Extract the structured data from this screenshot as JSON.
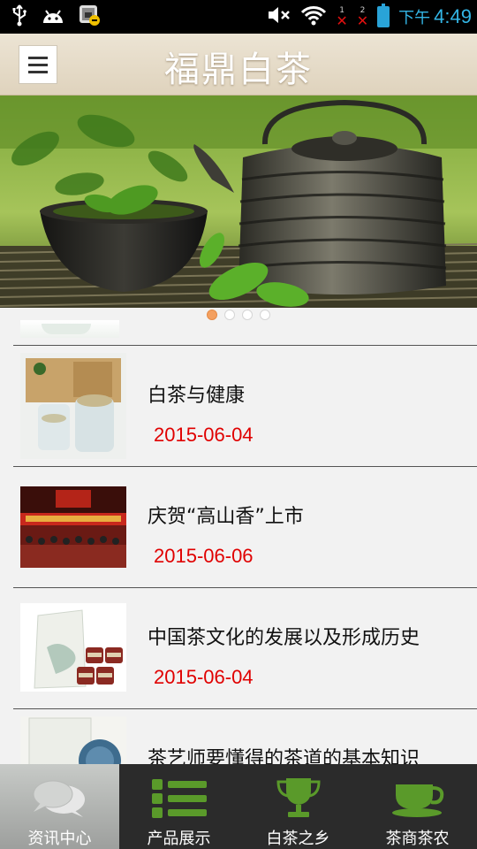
{
  "status_bar": {
    "icons": [
      "usb-icon",
      "android-icon",
      "security-shield-icon",
      "mute-icon",
      "wifi-icon",
      "sim1-no-signal-icon",
      "sim2-no-signal-icon",
      "battery-icon"
    ],
    "sim1_label": "1",
    "sim2_label": "2",
    "ampm": "下午",
    "time": "4:49"
  },
  "header": {
    "title": "福鼎白茶",
    "menu_icon": "hamburger-menu-icon"
  },
  "banner": {
    "slide_count": 4,
    "active_slide": 1
  },
  "list": {
    "items": [
      {
        "title": "白茶与健康",
        "date": "2015-06-04"
      },
      {
        "title": "庆贺“高山香”上市",
        "date": "2015-06-06"
      },
      {
        "title": "中国茶文化的发展以及形成历史",
        "date": "2015-06-04"
      },
      {
        "title": "茶艺师要懂得的茶道的基本知识",
        "date": ""
      }
    ]
  },
  "bottom_nav": {
    "tabs": [
      {
        "label": "资讯中心",
        "icon": "chat-bubbles-icon",
        "active": true
      },
      {
        "label": "产品展示",
        "icon": "list-icon",
        "active": false
      },
      {
        "label": "白茶之乡",
        "icon": "trophy-icon",
        "active": false
      },
      {
        "label": "茶商茶农",
        "icon": "teacup-icon",
        "active": false
      }
    ]
  },
  "colors": {
    "date_red": "#e00000",
    "time_blue": "#33b5e5",
    "nav_green": "#5a9a2a",
    "active_dot": "#f4a060"
  }
}
